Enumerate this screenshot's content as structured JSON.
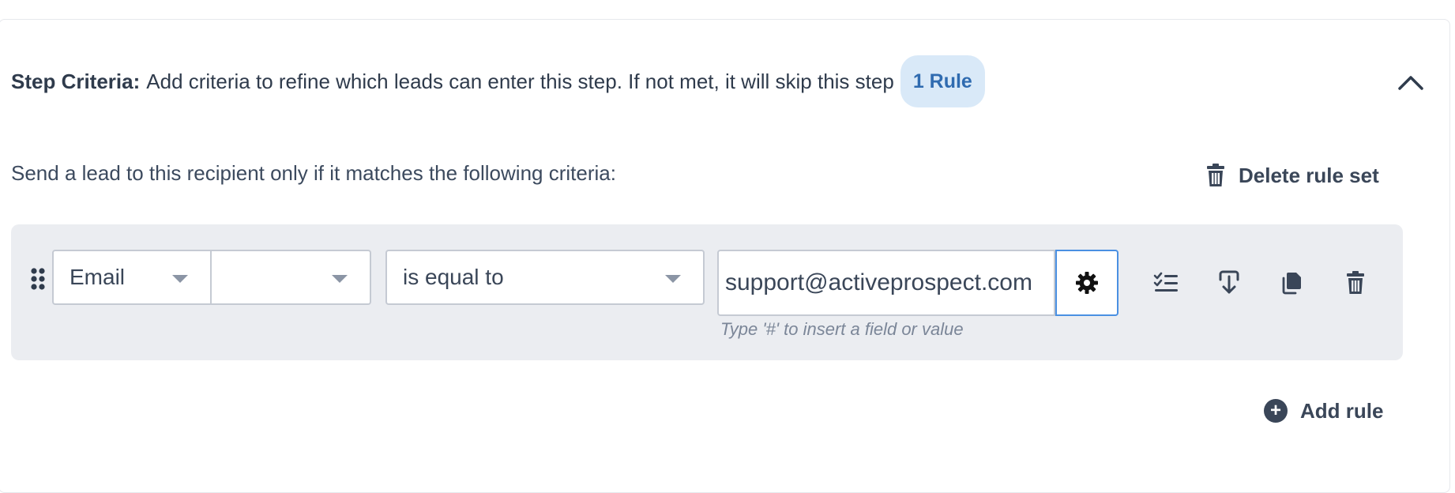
{
  "header": {
    "label": "Step Criteria:",
    "description": "Add criteria to refine which leads can enter this step. If not met, it will skip this step",
    "rule_count_badge": "1 Rule"
  },
  "section": {
    "subtitle": "Send a lead to this recipient only if it matches the following criteria:",
    "delete_rule_set_label": "Delete rule set"
  },
  "rule": {
    "field": "Email",
    "subfield": "",
    "operator": "is equal to",
    "value": "support@activeprospect.com",
    "hint": "Type '#' to insert a field or value"
  },
  "footer": {
    "add_rule_label": "Add rule"
  },
  "icons": {
    "plus": "+"
  },
  "colors": {
    "badge_bg": "#d9e9f8",
    "badge_text": "#2f6bb0",
    "rule_box_bg": "#ebedf1",
    "focus_border": "#4a90e2"
  }
}
